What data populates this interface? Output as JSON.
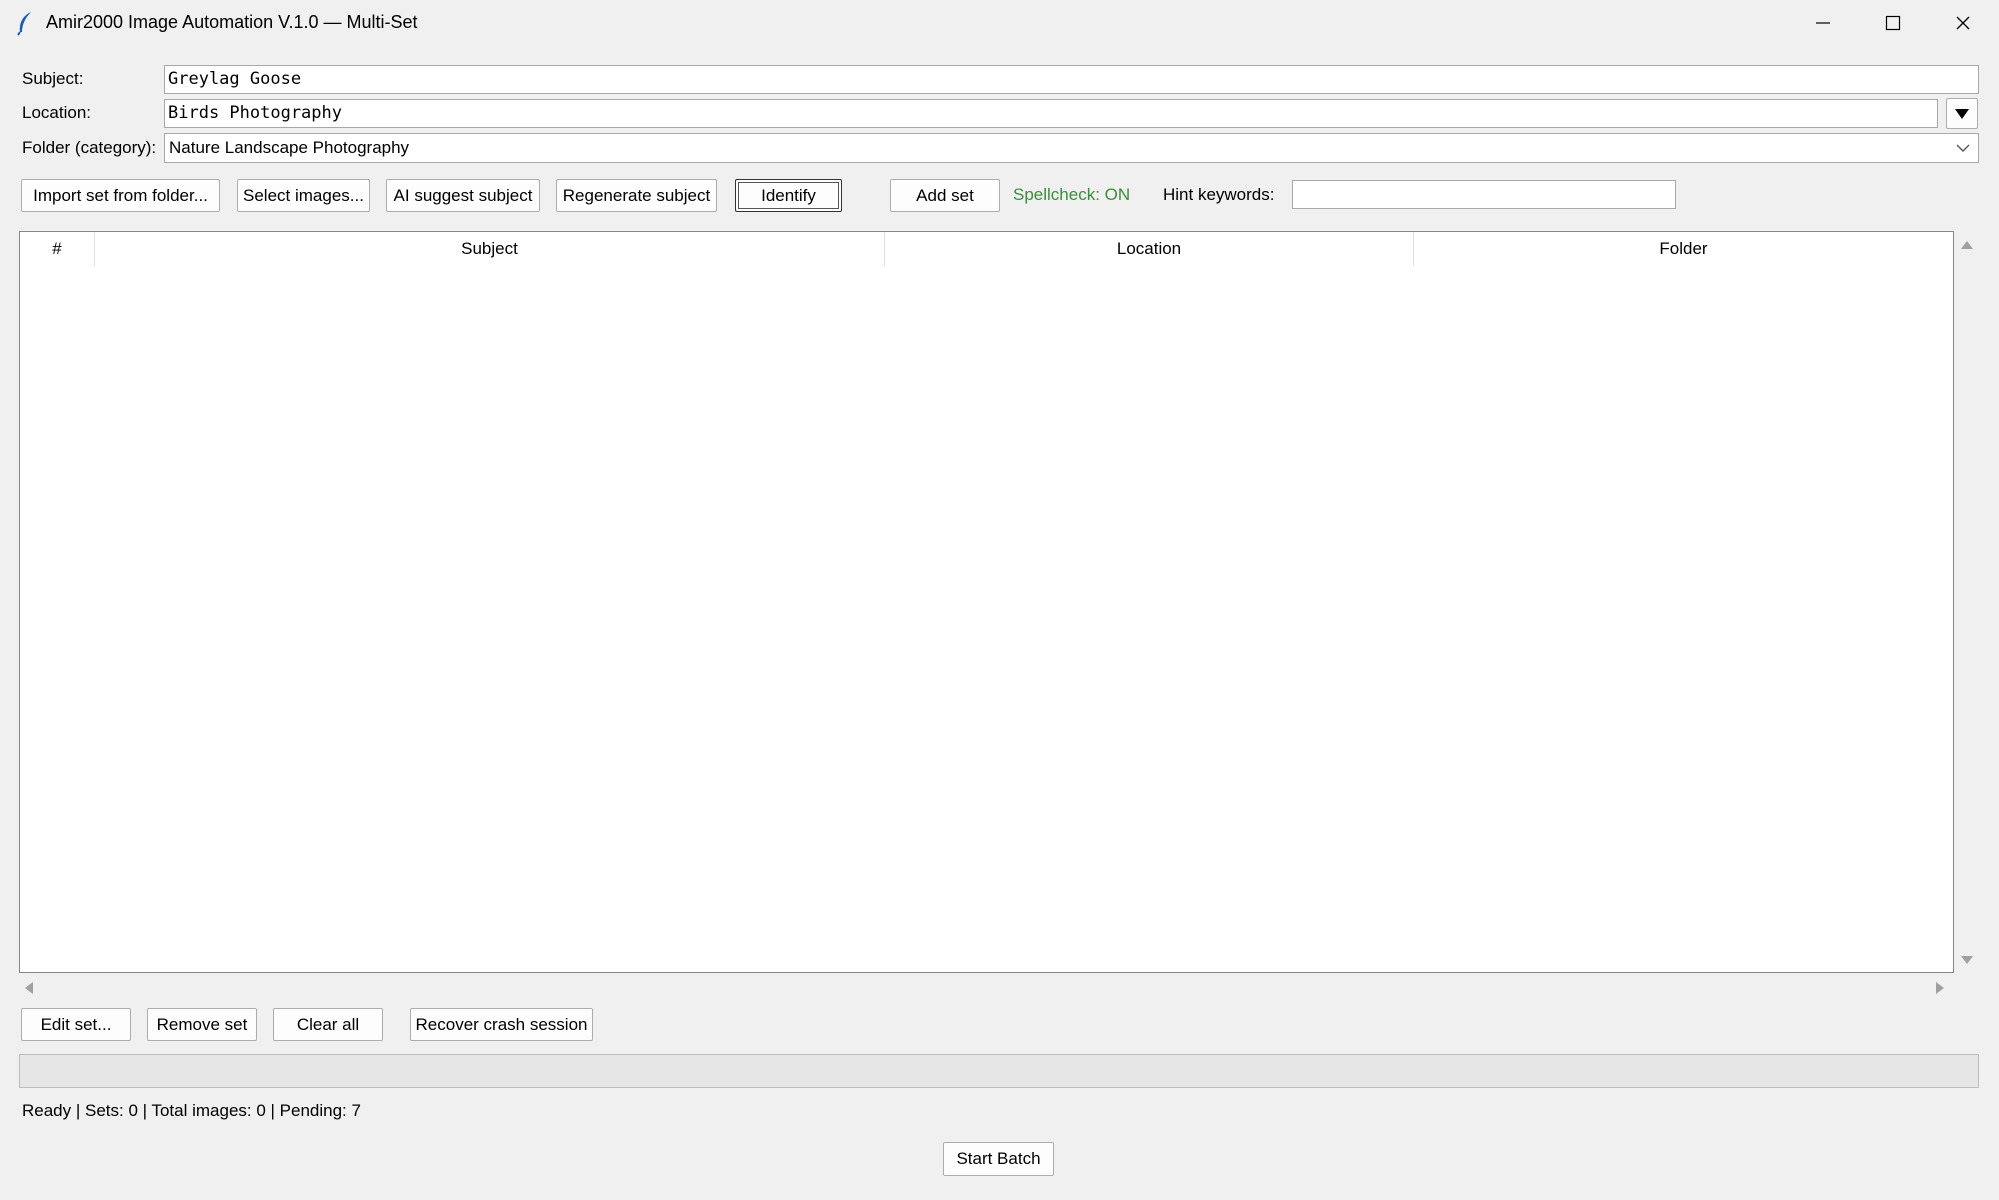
{
  "window": {
    "title": "Amir2000 Image Automation V.1.0 — Multi-Set",
    "icon": "feather-icon"
  },
  "form": {
    "subject_label": "Subject:",
    "subject_value": "Greylag Goose",
    "location_label": "Location:",
    "location_value": "Birds Photography",
    "folder_label": "Folder (category):",
    "folder_value": "Nature Landscape Photography"
  },
  "toolbar": {
    "import_label": "Import set from folder...",
    "select_label": "Select images...",
    "ai_suggest_label": "AI suggest subject",
    "regenerate_label": "Regenerate subject",
    "identify_label": "Identify",
    "add_set_label": "Add set",
    "spellcheck_text": "Spellcheck: ON",
    "hint_label": "Hint keywords:",
    "hint_value": ""
  },
  "table": {
    "columns": [
      "#",
      "Subject",
      "Location",
      "Folder"
    ],
    "rows": []
  },
  "actions": {
    "edit_label": "Edit set...",
    "remove_label": "Remove set",
    "clear_label": "Clear all",
    "recover_label": "Recover crash session"
  },
  "status": {
    "text": "Ready | Sets: 0 | Total images: 0 | Pending: 7",
    "progress": 0
  },
  "footer": {
    "start_label": "Start Batch"
  },
  "colors": {
    "spellcheck_on": "#3c8c3c",
    "window_bg": "#f0f0f0"
  }
}
